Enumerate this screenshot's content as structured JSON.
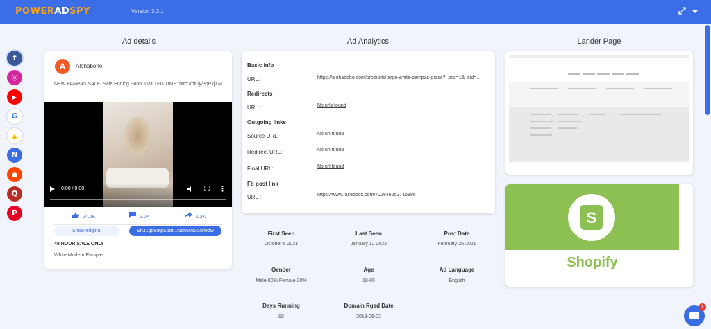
{
  "header": {
    "logo_part1": "POWER",
    "logo_part2": "AD",
    "logo_part3": "SPY",
    "version": "Version 3.3.1"
  },
  "sections": {
    "ad_details": "Ad details",
    "ad_analytics": "Ad Analytics",
    "lander_page": "Lander Page"
  },
  "social_nav": [
    {
      "name": "facebook",
      "glyph": "f",
      "color": "#3b5998"
    },
    {
      "name": "instagram",
      "glyph": "◎",
      "color": "#d6249f"
    },
    {
      "name": "youtube",
      "glyph": "▶",
      "color": "#ff0000"
    },
    {
      "name": "google",
      "glyph": "G",
      "color": "#ffffff"
    },
    {
      "name": "google-ads",
      "glyph": "▲",
      "color": "#ffffff"
    },
    {
      "name": "native",
      "glyph": "N",
      "color": "#3b6ee6"
    },
    {
      "name": "reddit",
      "glyph": "●",
      "color": "#ff4500"
    },
    {
      "name": "quora",
      "glyph": "Q",
      "color": "#b92b27"
    },
    {
      "name": "pinterest",
      "glyph": "P",
      "color": "#e60023"
    }
  ],
  "ad": {
    "avatar_letter": "A",
    "advertiser": "Alohaboho",
    "text": "NEW PAMPAS SALE. Sale Ending Soon. LIMITED TIME: http://bit.ly/3qPxjXM",
    "video_time": "0:00 / 0:08",
    "likes": "24.0K",
    "comments": "2.0K",
    "shares": "1.3K",
    "show_original": "Show original",
    "link_button": "Sh31go8utpSpot 1Non50suuorledw",
    "headline": "48 HOUR SALE ONLY",
    "description": "White Modern Pampas"
  },
  "analytics": {
    "basic_info": "Basic info",
    "url_label": "URL:",
    "url_value": "https://alohaboho.com/products/large-white-pampas-grass?_pos=1&_sid=...",
    "redirects": "Redirects",
    "redirects_url_label": "URL:",
    "redirects_url_value": "No urls found",
    "outgoing_links": "Outgoing links",
    "source_label": "Source URL:",
    "source_value": "No url found",
    "redirect_label": "Redirect URL:",
    "redirect_value": "No url found",
    "final_label": "Final URL:",
    "final_value": "No url found",
    "fb_post_link": "Fb post link",
    "fb_url_label": "URL :",
    "fb_url_value": "https://www.facebook.com/702846253716896"
  },
  "stats": {
    "first_seen_label": "First Seen",
    "first_seen": "October 6 2021",
    "last_seen_label": "Last Seen",
    "last_seen": "January 12 2022",
    "post_date_label": "Post Date",
    "post_date": "February 25 2021",
    "gender_label": "Gender",
    "gender": "Male-80% Female-20%",
    "age_label": "Age",
    "age": "18-65",
    "language_label": "Ad Language",
    "language": "English",
    "days_running_label": "Days Running",
    "days_running": "98",
    "domain_label": "Domain Rgsd Date",
    "domain_date": "2018-06-02"
  },
  "lander": {
    "shopify_word": "Shopify",
    "shopify_glyph": "S"
  },
  "chat": {
    "badge": "1"
  },
  "colors": {
    "primary": "#3b6ee6",
    "accent": "#f7a21b",
    "shopify": "#8dc053"
  }
}
